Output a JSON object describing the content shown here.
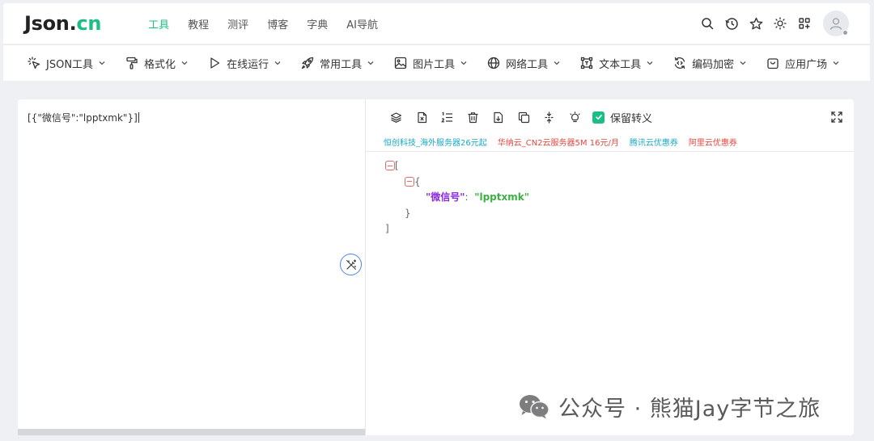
{
  "header": {
    "logo_main": "Json.",
    "logo_suffix": "cn",
    "nav": [
      {
        "label": "工具",
        "active": true
      },
      {
        "label": "教程",
        "active": false
      },
      {
        "label": "测评",
        "active": false
      },
      {
        "label": "博客",
        "active": false
      },
      {
        "label": "字典",
        "active": false
      },
      {
        "label": "AI导航",
        "active": false
      }
    ],
    "icons": [
      "search-icon",
      "history-icon",
      "star-icon",
      "sun-icon",
      "apps-icon",
      "user-avatar-icon"
    ]
  },
  "toolbar": {
    "items": [
      {
        "label": "JSON工具",
        "icon": "cursor-click-icon"
      },
      {
        "label": "格式化",
        "icon": "paint-roller-icon"
      },
      {
        "label": "在线运行",
        "icon": "play-icon"
      },
      {
        "label": "常用工具",
        "icon": "rocket-icon"
      },
      {
        "label": "图片工具",
        "icon": "image-icon"
      },
      {
        "label": "网络工具",
        "icon": "globe-icon"
      },
      {
        "label": "文本工具",
        "icon": "text-frame-icon"
      },
      {
        "label": "编码加密",
        "icon": "refresh-code-icon"
      },
      {
        "label": "应用广场",
        "icon": "shopping-bag-icon"
      }
    ]
  },
  "editor": {
    "input_value": "[{\"微信号\":\"lpptxmk\"}]"
  },
  "output": {
    "tool_icons": [
      "layers-icon",
      "excel-file-icon",
      "list-order-icon",
      "trash-icon",
      "download-icon",
      "copy-icon",
      "compress-icon",
      "lightbulb-icon"
    ],
    "escape_label": "保留转义",
    "escape_checked": true,
    "ads": [
      {
        "text": "恒创科技_海外服务器26元起",
        "color": "cyan"
      },
      {
        "text": "华纳云_CN2云服务器5M 16元/月",
        "color": "red"
      },
      {
        "text": "腾讯云优惠券",
        "color": "cyan"
      },
      {
        "text": "阿里云优惠券",
        "color": "red"
      }
    ],
    "tree": {
      "open_array": "[",
      "open_object": "{",
      "key": "\"微信号\"",
      "colon": ":",
      "value": "\"lpptxmk\"",
      "close_object": "}",
      "close_array": "]"
    }
  },
  "watermark": {
    "text": "公众号 · 熊猫Jay字节之旅"
  },
  "colors": {
    "accent": "#1bbf85",
    "json_key": "#8a2be2",
    "json_value": "#3cb043",
    "ad_cyan": "#1aa8c7",
    "ad_red": "#e8453c"
  }
}
